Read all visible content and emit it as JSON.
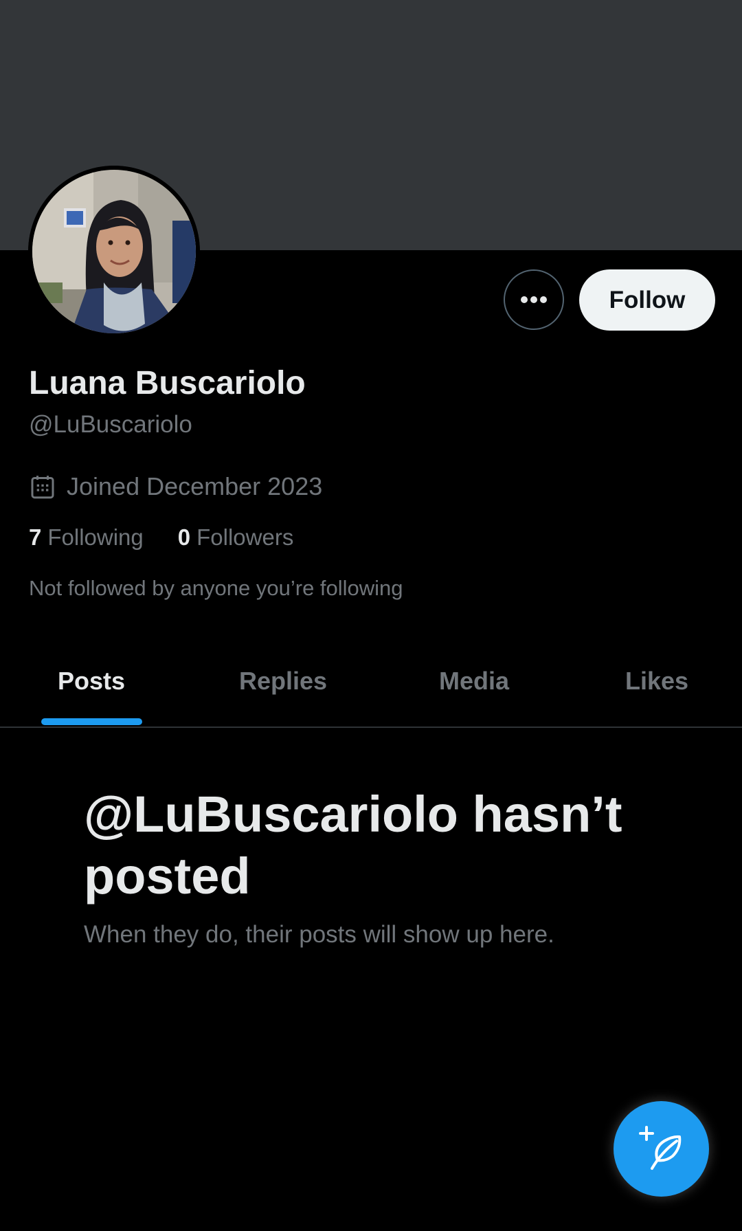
{
  "colors": {
    "accent": "#1d9bf0",
    "banner": "#333639",
    "background": "#000000",
    "text_primary": "#e7e9ea",
    "text_secondary": "#71767b",
    "follow_button_bg": "#eff3f4"
  },
  "profile": {
    "display_name": "Luana Buscariolo",
    "handle": "@LuBuscariolo",
    "joined": "Joined December 2023",
    "joined_icon": "calendar-icon",
    "avatar_icon": "avatar"
  },
  "actions": {
    "more_icon": "more-icon",
    "follow_label": "Follow"
  },
  "stats": {
    "following_count": "7",
    "following_label": "Following",
    "followers_count": "0",
    "followers_label": "Followers"
  },
  "not_followed_text": "Not followed by anyone you’re following",
  "tabs": [
    {
      "label": "Posts",
      "active": true
    },
    {
      "label": "Replies",
      "active": false
    },
    {
      "label": "Media",
      "active": false
    },
    {
      "label": "Likes",
      "active": false
    }
  ],
  "empty_state": {
    "title": "@LuBuscariolo hasn’t posted",
    "subtitle": "When they do, their posts will show up here."
  },
  "fab": {
    "icon": "compose-post-icon"
  }
}
